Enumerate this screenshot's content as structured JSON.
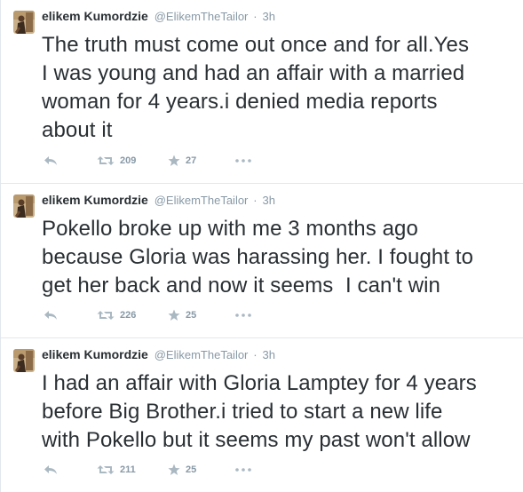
{
  "tweets": [
    {
      "fullname": "elikem Kumordzie",
      "username": "@ElikemTheTailor",
      "separator": "·",
      "time": "3h",
      "lines": [
        "The truth must come out once and for all.Yes",
        "I was young and had an affair with a married",
        "woman for 4 years.i denied media reports",
        "about it"
      ],
      "retweets": "209",
      "favorites": "27"
    },
    {
      "fullname": "elikem Kumordzie",
      "username": "@ElikemTheTailor",
      "separator": "·",
      "time": "3h",
      "lines": [
        "Pokello broke up with me 3 months ago",
        "because Gloria was harassing her. I fought to",
        "get her back and now it seems  I can't win"
      ],
      "retweets": "226",
      "favorites": "25"
    },
    {
      "fullname": "elikem Kumordzie",
      "username": "@ElikemTheTailor",
      "separator": "·",
      "time": "3h",
      "lines": [
        "I had an affair with Gloria Lamptey for 4 years",
        "before Big Brother.i tried to start a new life",
        "with Pokello but it seems my past won't allow"
      ],
      "retweets": "211",
      "favorites": "25"
    }
  ],
  "icons": {
    "reply": "reply-icon",
    "retweet": "retweet-icon",
    "favorite": "star-icon",
    "more": "ellipsis-icon"
  },
  "colors": {
    "icon": "#aab8c2",
    "meta": "#8899a6",
    "text": "#292f33",
    "border": "#e1e8ed"
  }
}
